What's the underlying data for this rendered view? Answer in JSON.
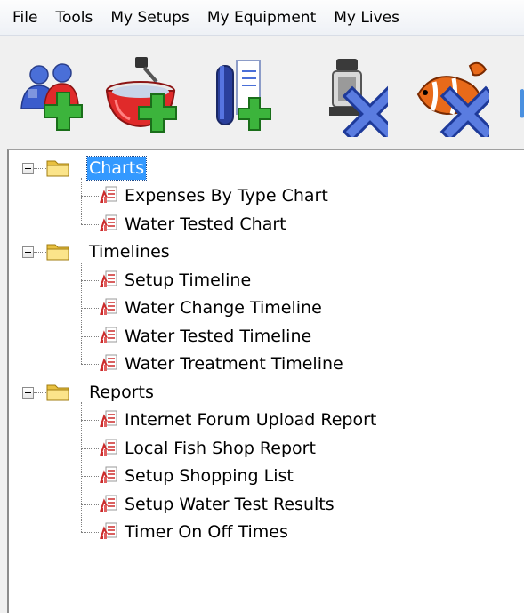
{
  "menu": {
    "items": [
      "File",
      "Tools",
      "My Setups",
      "My Equipment",
      "My Lives"
    ]
  },
  "toolbar": {
    "buttons": [
      {
        "icon": "add-users-icon"
      },
      {
        "icon": "add-water-bowl-icon"
      },
      {
        "icon": "add-test-tube-icon"
      },
      {
        "icon": "delete-equipment-icon"
      },
      {
        "icon": "delete-livestock-icon"
      }
    ]
  },
  "tree": {
    "groups": [
      {
        "label": "Charts",
        "selected": true,
        "items": [
          "Expenses By Type Chart",
          "Water Tested Chart"
        ]
      },
      {
        "label": "Timelines",
        "selected": false,
        "items": [
          "Setup Timeline",
          "Water Change Timeline",
          "Water Tested Timeline",
          "Water Treatment Timeline"
        ]
      },
      {
        "label": "Reports",
        "selected": false,
        "items": [
          "Internet Forum Upload Report",
          "Local Fish Shop Report",
          "Setup Shopping List",
          "Setup Water Test Results",
          "Timer On Off Times"
        ]
      }
    ]
  },
  "colors": {
    "selection": "#3399ff",
    "folder": "#f5d66a",
    "report_red": "#cc2a2a",
    "plus_green": "#3cb43c",
    "x_blue": "#3b5fd6"
  }
}
